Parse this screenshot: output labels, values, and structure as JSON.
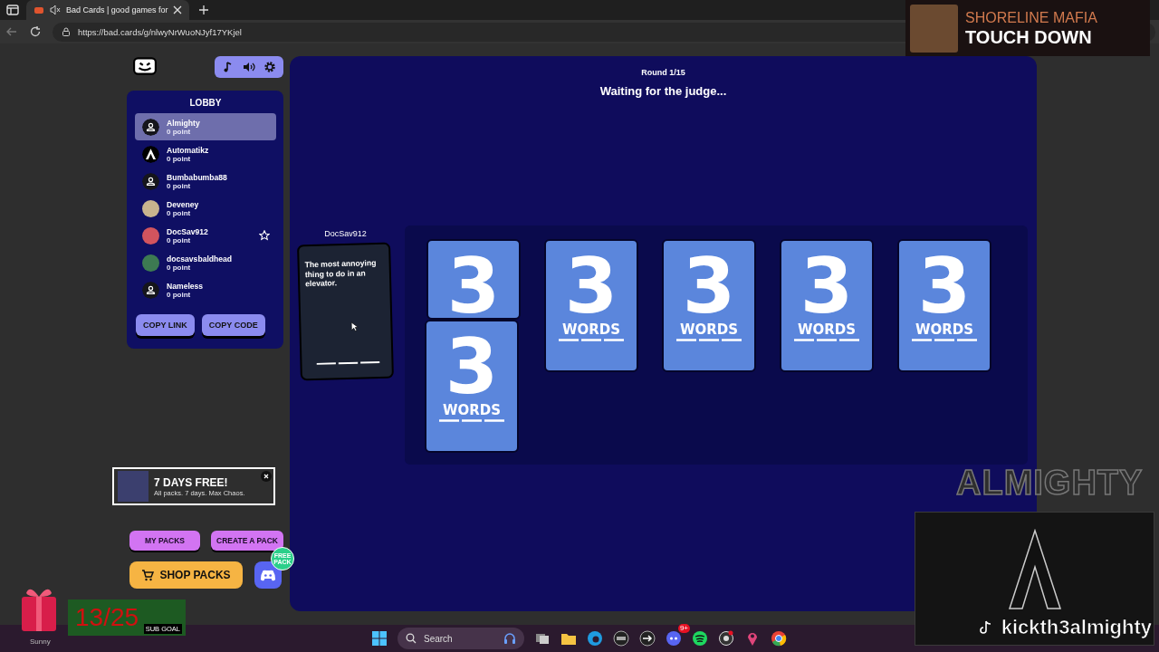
{
  "browser": {
    "tab_title": "Bad Cards | good games for",
    "url": "https://bad.cards/g/nlwyNrWuoNJyf17YKjel"
  },
  "now_playing": {
    "artist": "SHORELINE MAFIA",
    "title": "TOUCH DOWN"
  },
  "lobby": {
    "title": "LOBBY",
    "players": [
      {
        "name": "Almighty",
        "points": "0 point",
        "kind": "default",
        "selected": true,
        "host": false
      },
      {
        "name": "Automatikz",
        "points": "0 point",
        "kind": "logo",
        "selected": false,
        "host": false
      },
      {
        "name": "Bumbabumba88",
        "points": "0 point",
        "kind": "default",
        "selected": false,
        "host": false
      },
      {
        "name": "Deveney",
        "points": "0 point",
        "kind": "photo",
        "color": "#c9b48e",
        "selected": false,
        "host": false
      },
      {
        "name": "DocSav912",
        "points": "0 point",
        "kind": "photo",
        "color": "#d2545e",
        "selected": false,
        "host": true
      },
      {
        "name": "docsavsbaldhead",
        "points": "0 point",
        "kind": "photo",
        "color": "#3d7a52",
        "selected": false,
        "host": false
      },
      {
        "name": "Nameless",
        "points": "0 point",
        "kind": "default",
        "selected": false,
        "host": false
      }
    ],
    "buttons": [
      "COPY LINK",
      "COPY CODE"
    ]
  },
  "promo": {
    "headline": "7 DAYS FREE!",
    "subline": "All packs. 7 days. Max Chaos."
  },
  "pack_buttons": [
    "MY PACKS",
    "CREATE A PACK"
  ],
  "shop_button": "SHOP PACKS",
  "discord_badge": "FREE PACK",
  "game": {
    "round": "Round 1/15",
    "status": "Waiting for the judge...",
    "judge": "DocSav912",
    "prompt": "The most annoying thing to do in an elevator.",
    "answer_cards": [
      {
        "number": "3"
      },
      {
        "number": "3",
        "label": "WORDS"
      },
      {
        "number": "3",
        "label": "WORDS"
      },
      {
        "number": "3",
        "label": "WORDS"
      },
      {
        "number": "3",
        "label": "WORDS"
      }
    ],
    "top_card": {
      "number": "3",
      "label": "WORDS"
    }
  },
  "stream_overlay": {
    "goal": "13/25",
    "goal_label": "SUB GOAL",
    "viewer": "Sunny",
    "brand": "ALMIGHTY",
    "handle": "kickth3almighty"
  },
  "taskbar": {
    "search": "Search",
    "chat_badge": "9+"
  }
}
